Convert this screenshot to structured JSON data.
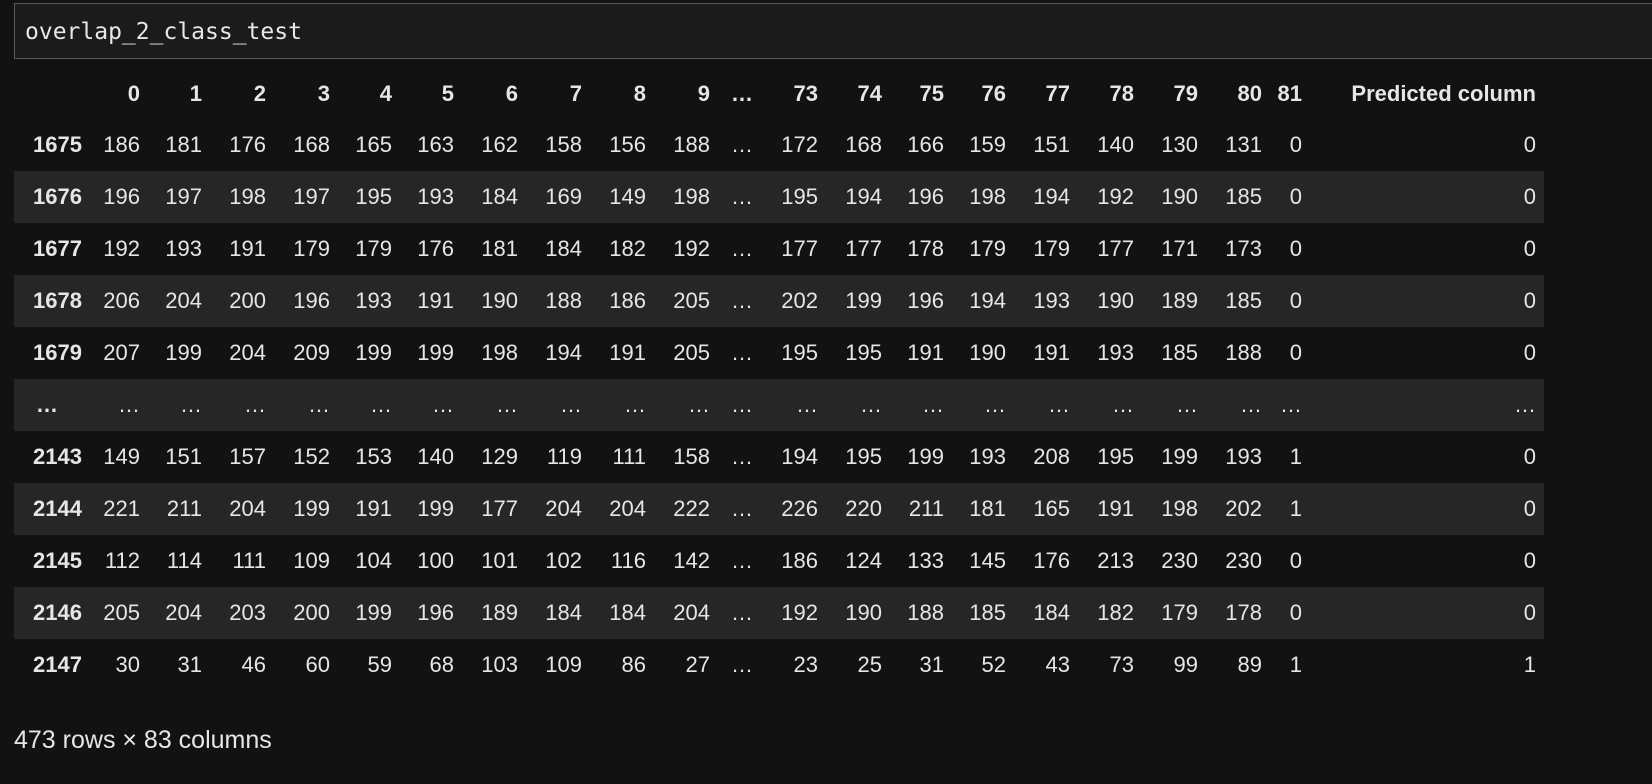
{
  "cell_input": {
    "code": "overlap_2_class_test"
  },
  "table": {
    "columns": [
      "0",
      "1",
      "2",
      "3",
      "4",
      "5",
      "6",
      "7",
      "8",
      "9",
      "…",
      "73",
      "74",
      "75",
      "76",
      "77",
      "78",
      "79",
      "80",
      "81",
      "Predicted column"
    ],
    "rows": [
      {
        "index": "1675",
        "cells": [
          "186",
          "181",
          "176",
          "168",
          "165",
          "163",
          "162",
          "158",
          "156",
          "188",
          "…",
          "172",
          "168",
          "166",
          "159",
          "151",
          "140",
          "130",
          "131",
          "0",
          "0"
        ]
      },
      {
        "index": "1676",
        "cells": [
          "196",
          "197",
          "198",
          "197",
          "195",
          "193",
          "184",
          "169",
          "149",
          "198",
          "…",
          "195",
          "194",
          "196",
          "198",
          "194",
          "192",
          "190",
          "185",
          "0",
          "0"
        ]
      },
      {
        "index": "1677",
        "cells": [
          "192",
          "193",
          "191",
          "179",
          "179",
          "176",
          "181",
          "184",
          "182",
          "192",
          "…",
          "177",
          "177",
          "178",
          "179",
          "179",
          "177",
          "171",
          "173",
          "0",
          "0"
        ]
      },
      {
        "index": "1678",
        "cells": [
          "206",
          "204",
          "200",
          "196",
          "193",
          "191",
          "190",
          "188",
          "186",
          "205",
          "…",
          "202",
          "199",
          "196",
          "194",
          "193",
          "190",
          "189",
          "185",
          "0",
          "0"
        ]
      },
      {
        "index": "1679",
        "cells": [
          "207",
          "199",
          "204",
          "209",
          "199",
          "199",
          "198",
          "194",
          "191",
          "205",
          "…",
          "195",
          "195",
          "191",
          "190",
          "191",
          "193",
          "185",
          "188",
          "0",
          "0"
        ]
      },
      {
        "index": "…",
        "cells": [
          "…",
          "…",
          "…",
          "…",
          "…",
          "…",
          "…",
          "…",
          "…",
          "…",
          "…",
          "…",
          "…",
          "…",
          "…",
          "…",
          "…",
          "…",
          "…",
          "…",
          "…"
        ]
      },
      {
        "index": "2143",
        "cells": [
          "149",
          "151",
          "157",
          "152",
          "153",
          "140",
          "129",
          "119",
          "111",
          "158",
          "…",
          "194",
          "195",
          "199",
          "193",
          "208",
          "195",
          "199",
          "193",
          "1",
          "0"
        ]
      },
      {
        "index": "2144",
        "cells": [
          "221",
          "211",
          "204",
          "199",
          "191",
          "199",
          "177",
          "204",
          "204",
          "222",
          "…",
          "226",
          "220",
          "211",
          "181",
          "165",
          "191",
          "198",
          "202",
          "1",
          "0"
        ]
      },
      {
        "index": "2145",
        "cells": [
          "112",
          "114",
          "111",
          "109",
          "104",
          "100",
          "101",
          "102",
          "116",
          "142",
          "…",
          "186",
          "124",
          "133",
          "145",
          "176",
          "213",
          "230",
          "230",
          "0",
          "0"
        ]
      },
      {
        "index": "2146",
        "cells": [
          "205",
          "204",
          "203",
          "200",
          "199",
          "196",
          "189",
          "184",
          "184",
          "204",
          "…",
          "192",
          "190",
          "188",
          "185",
          "184",
          "182",
          "179",
          "178",
          "0",
          "0"
        ]
      },
      {
        "index": "2147",
        "cells": [
          "30",
          "31",
          "46",
          "60",
          "59",
          "68",
          "103",
          "109",
          "86",
          "27",
          "…",
          "23",
          "25",
          "31",
          "52",
          "43",
          "73",
          "99",
          "89",
          "1",
          "1"
        ]
      }
    ]
  },
  "summary": "473 rows × 83 columns"
}
